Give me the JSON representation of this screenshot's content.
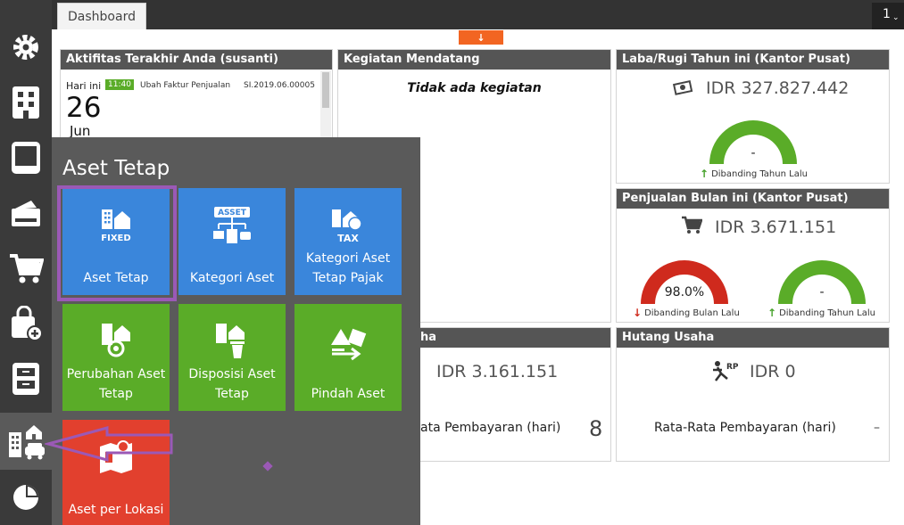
{
  "topbar": {
    "tab_dashboard": "Dashboard",
    "right_number": "1",
    "collapse_arrow": "↓"
  },
  "sidebar": {
    "items": [
      {
        "icon": "settings-icon"
      },
      {
        "icon": "building-icon"
      },
      {
        "icon": "book-icon"
      },
      {
        "icon": "wallet-icon"
      },
      {
        "icon": "cart-icon"
      },
      {
        "icon": "shopping-bag-add-icon"
      },
      {
        "icon": "cabinet-icon"
      },
      {
        "icon": "fixed-asset-icon"
      },
      {
        "icon": "pie-chart-icon"
      }
    ]
  },
  "activity": {
    "title": "Aktifitas Terakhir Anda (susanti)",
    "day_label": "Hari ini",
    "time": "11:40",
    "action": "Ubah Faktur Penjualan",
    "doc": "SI.2019.06.00005",
    "day": "26",
    "month": "Jun"
  },
  "upcoming": {
    "title": "Kegiatan Mendatang",
    "empty": "Tidak ada kegiatan"
  },
  "profit": {
    "title": "Laba/Rugi Tahun ini (Kantor Pusat)",
    "amount": "IDR 327.827.442",
    "gauge_value": "-",
    "compare": "Dibanding Tahun Lalu"
  },
  "sales": {
    "title": "Penjualan Bulan ini (Kantor Pusat)",
    "amount": "IDR 3.671.151",
    "month_pct": "98.0%",
    "month_compare": "Dibanding Bulan Lalu",
    "year_value": "-",
    "year_compare": "Dibanding Tahun Lalu"
  },
  "receivable": {
    "title_fragment": "ha",
    "amount": "IDR 3.161.151",
    "avg_label": "ata Pembayaran (hari)",
    "avg_value": "8"
  },
  "payable": {
    "title": "Hutang Usaha",
    "amount": "IDR 0",
    "avg_label": "Rata-Rata Pembayaran (hari)",
    "avg_value": "–"
  },
  "flyout": {
    "title": "Aset Tetap",
    "tiles": [
      {
        "label": "Aset Tetap",
        "icon_text": "FIXED",
        "color": "#3a86db"
      },
      {
        "label": "Kategori Aset",
        "icon_text": "ASSET",
        "color": "#3a86db"
      },
      {
        "label": "Kategori Aset Tetap Pajak",
        "icon_text": "TAX",
        "color": "#3a86db"
      },
      {
        "label": "Perubahan Aset Tetap",
        "color": "#5aac28"
      },
      {
        "label": "Disposisi Aset Tetap",
        "color": "#5aac28"
      },
      {
        "label": "Pindah Aset",
        "color": "#5aac28"
      },
      {
        "label": "Aset per Lokasi",
        "color": "#e2402e"
      }
    ]
  },
  "colors": {
    "accent": "#9b59b6",
    "gauge_green": "#5aac28",
    "gauge_red": "#cf2a1d",
    "header": "#555555"
  }
}
